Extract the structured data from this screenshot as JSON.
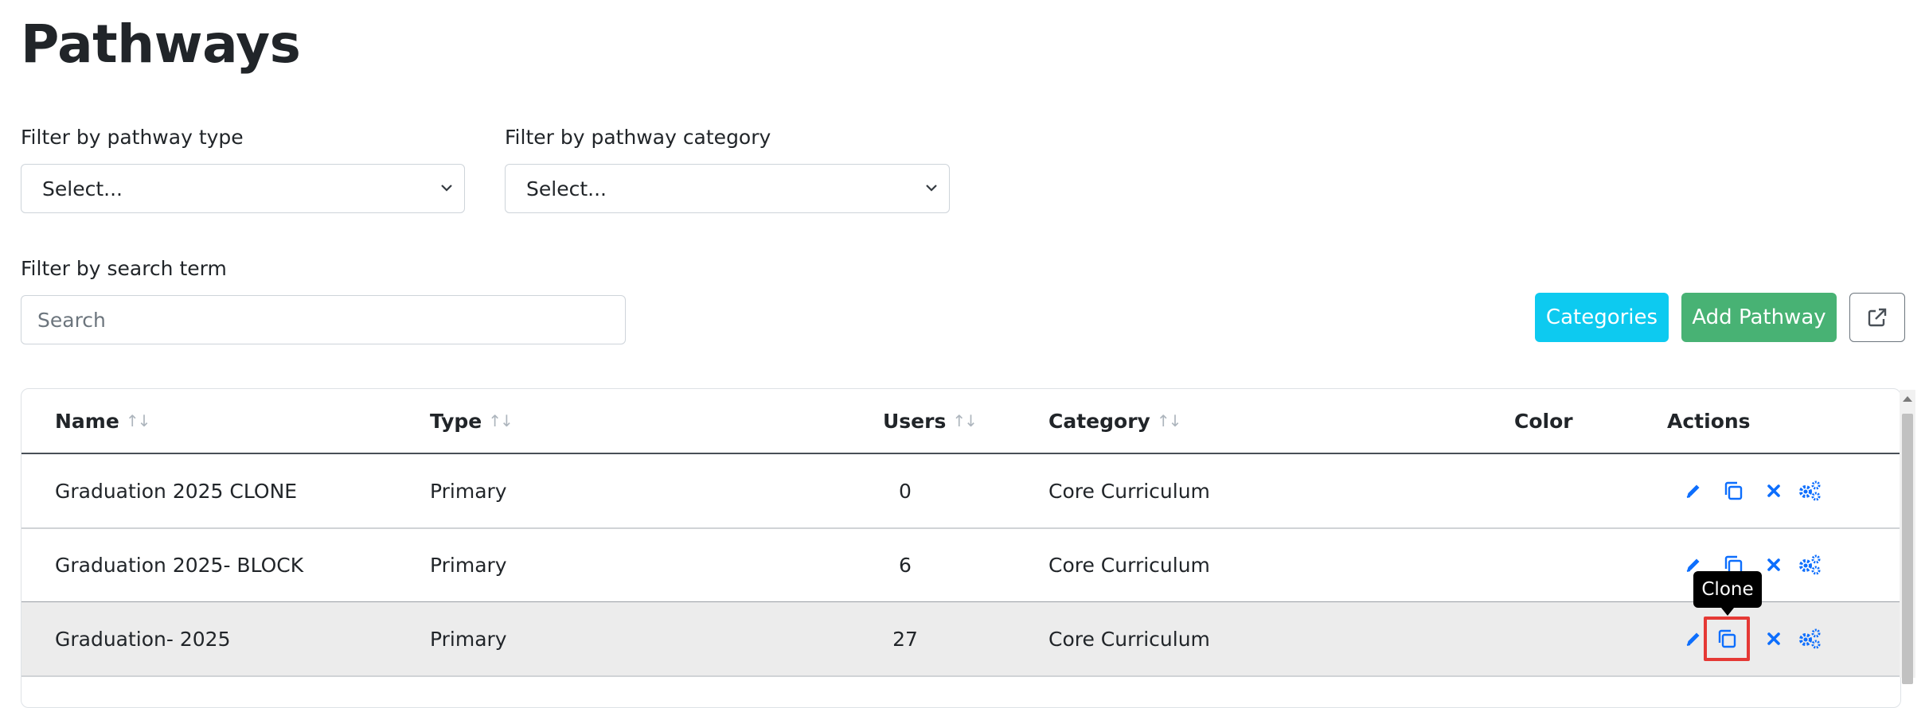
{
  "page": {
    "title": "Pathways"
  },
  "filters": {
    "type_label": "Filter by pathway type",
    "type_value": "Select...",
    "category_label": "Filter by pathway category",
    "category_value": "Select...",
    "search_label": "Filter by search term",
    "search_placeholder": "Search"
  },
  "toolbar": {
    "categories_label": "Categories",
    "add_label": "Add Pathway",
    "external_icon": "external-link-icon",
    "colors": {
      "categories": "#0dcaf0",
      "add": "#48b274"
    }
  },
  "table": {
    "columns": [
      "Name",
      "Type",
      "Users",
      "Category",
      "Color",
      "Actions"
    ],
    "sortable": [
      true,
      true,
      true,
      true,
      false,
      false
    ],
    "rows": [
      {
        "name": "Graduation 2025 CLONE",
        "type": "Primary",
        "users": "0",
        "category": "Core Curriculum"
      },
      {
        "name": "Graduation 2025- BLOCK",
        "type": "Primary",
        "users": "6",
        "category": "Core Curriculum"
      },
      {
        "name": "Graduation- 2025",
        "type": "Primary",
        "users": "27",
        "category": "Core Curriculum"
      }
    ],
    "action_icons": [
      "edit-icon",
      "clone-icon",
      "delete-icon",
      "settings-icon"
    ],
    "action_color": "#0d6efd"
  },
  "tooltip": {
    "text": "Clone"
  }
}
